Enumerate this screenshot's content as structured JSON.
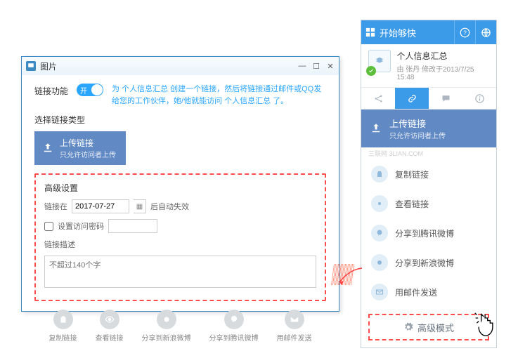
{
  "dialog": {
    "title": "图片",
    "func_label": "链接功能",
    "toggle_text": "开",
    "desc_html": "为 个人信息汇总 创建一个链接，然后将链接通过邮件或QQ发给您的工作伙伴，她/他就能访问 个人信息汇总 了。",
    "select_type": "选择链接类型",
    "upload": {
      "title": "上传链接",
      "sub": "只允许访问者上传"
    },
    "adv": {
      "title": "高级设置",
      "expire_prefix": "链接在",
      "expire_date": "2017-07-27",
      "expire_suffix": "后自动失效",
      "pw_label": "设置访问密码",
      "desc_label": "链接描述",
      "placeholder": "不超过140个字"
    },
    "actions": [
      "复制链接",
      "查看链接",
      "分享到新浪微博",
      "分享到腾讯微博",
      "用邮件发送"
    ]
  },
  "panel": {
    "head": "开始够快",
    "doc": {
      "name": "个人信息汇总",
      "meta": "由 张丹 修改于2013/7/25 15:48"
    },
    "upload": {
      "title": "上传链接",
      "sub": "只允许访问者上传"
    },
    "watermark": "三联网  3LIAN.COM",
    "items": [
      "复制链接",
      "查看链接",
      "分享到腾讯微博",
      "分享到新浪微博",
      "用邮件发送"
    ],
    "adv_mode": "高级模式"
  }
}
